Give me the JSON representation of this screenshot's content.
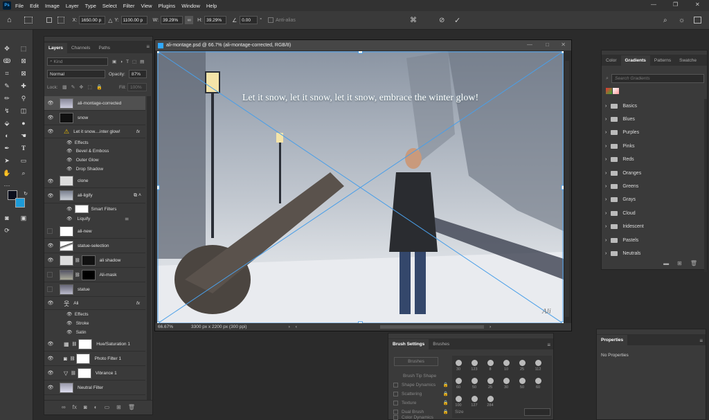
{
  "menubar": {
    "items": [
      "File",
      "Edit",
      "Image",
      "Layer",
      "Type",
      "Select",
      "Filter",
      "View",
      "Plugins",
      "Window",
      "Help"
    ]
  },
  "options": {
    "x_label": "X:",
    "x_value": "1650.00 p",
    "y_label": "Y:",
    "y_value": "1100.00 p",
    "w_label": "W:",
    "w_value": "39.29%",
    "h_label": "H:",
    "h_value": "39.29%",
    "angle_value": "0.00",
    "angle_unit": "°",
    "antialias": "Anti-alias"
  },
  "layers_panel": {
    "tabs": [
      "Layers",
      "Channels",
      "Paths"
    ],
    "kind_placeholder": "Kind",
    "blend_mode": "Normal",
    "opacity_label": "Opacity:",
    "opacity_value": "87%",
    "lock_label": "Lock:",
    "fill_label": "Fill:",
    "fill_value": "100%",
    "layers": [
      {
        "name": "ali-montage-corrected",
        "selected": true
      },
      {
        "name": "snow"
      },
      {
        "name": "Let it snow....inter glow!",
        "fx": "fx"
      },
      {
        "name": "clone"
      },
      {
        "name": "ali-ligify"
      },
      {
        "name": "ali-new"
      },
      {
        "name": "statue-selection"
      },
      {
        "name": "ali shadow"
      },
      {
        "name": "Ali-mask"
      },
      {
        "name": "statue"
      },
      {
        "name": "Ali",
        "fx": "fx"
      },
      {
        "name": "Hue/Saturation 1"
      },
      {
        "name": "Photo Filter 1"
      },
      {
        "name": "Vibrance 1"
      },
      {
        "name": "Neutral Filter"
      }
    ],
    "text_effects": {
      "label": "Effects",
      "items": [
        "Bevel & Emboss",
        "Outer Glow",
        "Drop Shadow"
      ]
    },
    "smart_filters": {
      "label": "Smart Filters",
      "items": [
        "Liquify"
      ]
    },
    "ali_effects": {
      "label": "Effects",
      "items": [
        "Stroke",
        "Satin"
      ]
    }
  },
  "document": {
    "title": "ali-montage.psd @ 66.7% (ali-montage-corrected, RGB/8)",
    "canvas_text": "Let it snow, let it snow, let it snow, embrace the winter glow!",
    "signature": "Ali",
    "zoom": "66.67%",
    "doc_size": "3300 px x 2200 px (300 ppi)"
  },
  "gradients_panel": {
    "tabs": [
      "Color",
      "Gradients",
      "Patterns",
      "Swatche"
    ],
    "search_placeholder": "Search Gradients",
    "groups": [
      "Basics",
      "Blues",
      "Purples",
      "Pinks",
      "Reds",
      "Oranges",
      "Greens",
      "Grays",
      "Cloud",
      "Iridescent",
      "Pastels",
      "Neutrals"
    ]
  },
  "brush_panel": {
    "tabs": [
      "Brush Settings",
      "Brushes"
    ],
    "brushes_button": "Brushes",
    "tip_shape": "Brush Tip Shape",
    "options": [
      "Shape Dynamics",
      "Scattering",
      "Texture",
      "Dual Brush",
      "Color Dynamics"
    ],
    "brush_sizes": [
      "30",
      "123",
      "8",
      "10",
      "25",
      "112",
      "60",
      "50",
      "25",
      "30",
      "50",
      "60",
      "100",
      "127",
      "284"
    ],
    "size_label": "Size"
  },
  "properties_panel": {
    "tab": "Properties",
    "empty_text": "No Properties"
  },
  "colors": {
    "foreground": "#0b0f1d",
    "background": "#1d9bd8",
    "accent": "#31a8ff",
    "transform_line": "#4a9fe8"
  }
}
